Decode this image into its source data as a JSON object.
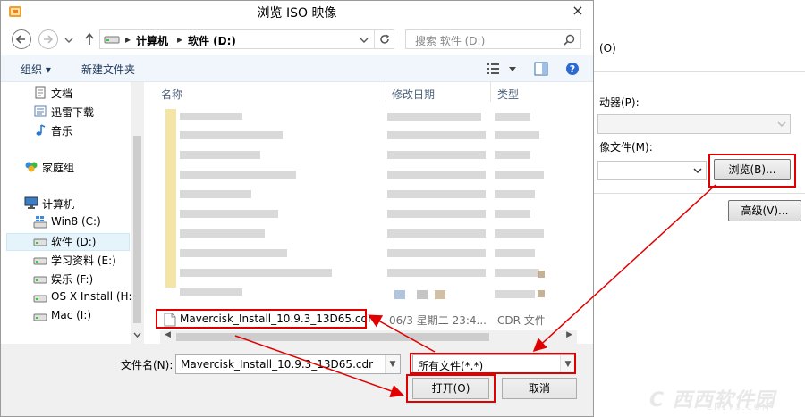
{
  "window": {
    "title": "浏览 ISO 映像",
    "close": "×"
  },
  "address": {
    "segments": [
      "计算机",
      "软件 (D:)"
    ]
  },
  "search": {
    "placeholder": "搜索 软件 (D:)"
  },
  "toolbar": {
    "organize": "组织",
    "new_folder": "新建文件夹"
  },
  "nav": {
    "items": [
      {
        "label": "文档",
        "icon": "document-icon"
      },
      {
        "label": "迅雷下载",
        "icon": "folder-icon"
      },
      {
        "label": "音乐",
        "icon": "music-icon"
      },
      {
        "label": "家庭组",
        "icon": "homegroup-icon"
      },
      {
        "label": "计算机",
        "icon": "computer-icon"
      },
      {
        "label": "Win8 (C:)",
        "icon": "drive-icon"
      },
      {
        "label": "软件 (D:)",
        "icon": "drive-icon"
      },
      {
        "label": "学习资料 (E:)",
        "icon": "drive-icon"
      },
      {
        "label": "娱乐 (F:)",
        "icon": "drive-icon"
      },
      {
        "label": "OS X Install (H:)",
        "icon": "drive-icon"
      },
      {
        "label": "Mac (I:)",
        "icon": "drive-icon"
      }
    ],
    "selected": "软件 (D:)"
  },
  "files": {
    "columns": [
      "名称",
      "修改日期",
      "类型"
    ],
    "highlighted": {
      "name": "Mavercisk_Install_10.9.3_13D65.cdr",
      "date": "06/3 星期二 23:4...",
      "type": "CDR 文件"
    }
  },
  "bottom": {
    "filename_label": "文件名(N):",
    "filename_value": "Mavercisk_Install_10.9.3_13D65.cdr",
    "filter": "所有文件(*.*)",
    "open": "打开(O)",
    "cancel": "取消"
  },
  "background_dialog": {
    "top_text": "(O)",
    "drive_label": "动器(P):",
    "image_label": "像文件(M):",
    "browse": "浏览(B)...",
    "advanced": "高级(V)..."
  },
  "colors": {
    "annotation": "#e00000",
    "accent": "#1e395b"
  }
}
